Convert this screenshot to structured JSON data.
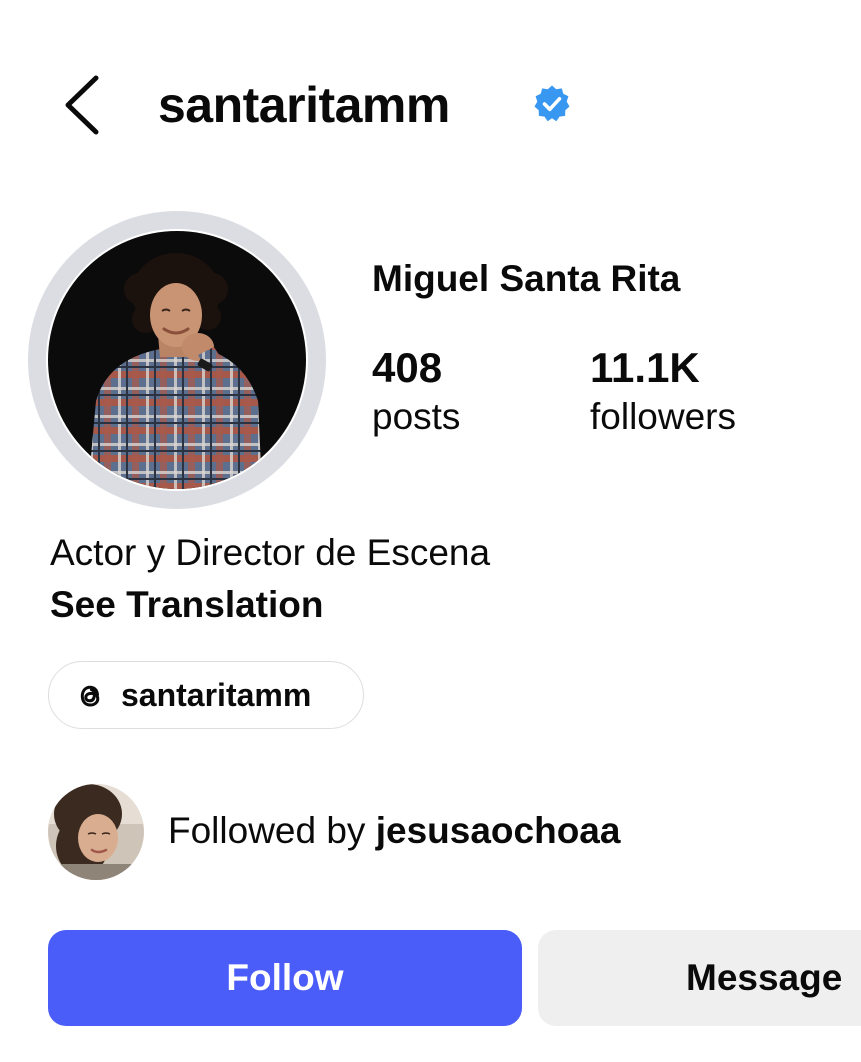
{
  "header": {
    "username": "santaritamm",
    "verified_color": "#3897f0"
  },
  "profile": {
    "full_name": "Miguel Santa Rita",
    "posts_count": "408",
    "posts_label": "posts",
    "followers_count": "11.1K",
    "followers_label": "followers",
    "bio": "Actor y Director de Escena",
    "see_translation": "See Translation",
    "threads_handle": "santaritamm"
  },
  "followed_by": {
    "prefix": "Followed by ",
    "username": "jesusaochoaa"
  },
  "actions": {
    "follow_label": "Follow",
    "message_label": "Message",
    "follow_color": "#4a5df9"
  },
  "icons": {
    "back": "chevron-left-icon",
    "verified": "verified-badge-icon",
    "threads": "threads-icon"
  }
}
